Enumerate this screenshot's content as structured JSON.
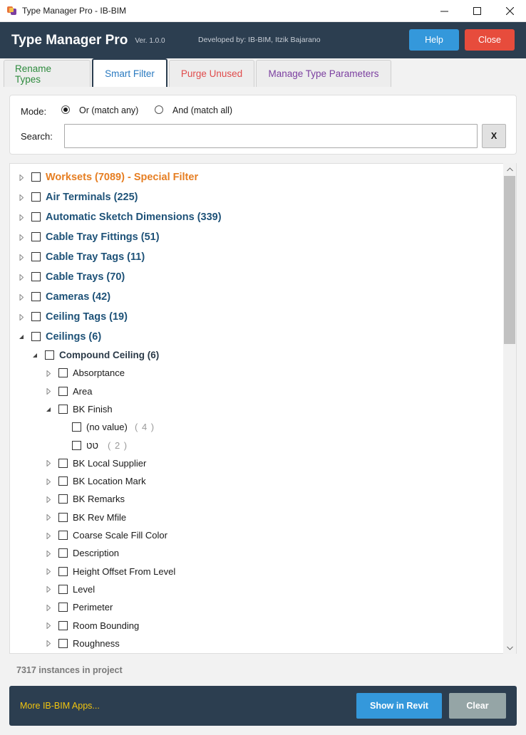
{
  "window": {
    "title": "Type Manager Pro - IB-BIM"
  },
  "header": {
    "brand": "Type Manager Pro",
    "version": "Ver. 1.0.0",
    "developer": "Developed by: IB-BIM, Itzik Bajarano",
    "help_label": "Help",
    "close_label": "Close"
  },
  "tabs": [
    {
      "label": "Rename Types",
      "active": false
    },
    {
      "label": "Smart Filter",
      "active": true
    },
    {
      "label": "Purge Unused",
      "active": false
    },
    {
      "label": "Manage Type Parameters",
      "active": false
    }
  ],
  "filter": {
    "mode_label": "Mode:",
    "mode_or": "Or (match any)",
    "mode_and": "And (match all)",
    "mode_selected": "or",
    "search_label": "Search:",
    "search_value": "",
    "clear_label": "X"
  },
  "tree": {
    "categories": [
      {
        "label": "Worksets (7089)  - Special Filter",
        "special": true,
        "expanded": false
      },
      {
        "label": "Air Terminals (225)",
        "expanded": false
      },
      {
        "label": "Automatic Sketch Dimensions (339)",
        "expanded": false
      },
      {
        "label": "Cable Tray Fittings (51)",
        "expanded": false
      },
      {
        "label": "Cable Tray Tags (11)",
        "expanded": false
      },
      {
        "label": "Cable Trays (70)",
        "expanded": false
      },
      {
        "label": "Cameras (42)",
        "expanded": false
      },
      {
        "label": "Ceiling Tags (19)",
        "expanded": false
      },
      {
        "label": "Ceilings (6)",
        "expanded": true
      }
    ],
    "family": {
      "label": "Compound Ceiling (6)",
      "expanded": true
    },
    "parameters_before": [
      {
        "label": "Absorptance"
      },
      {
        "label": "Area"
      }
    ],
    "bk_finish": {
      "label": "BK Finish",
      "values": [
        {
          "label": "(no value)",
          "count": "( 4 )"
        },
        {
          "label": "טט",
          "count": "( 2 )"
        }
      ]
    },
    "parameters_after": [
      {
        "label": "BK Local Supplier"
      },
      {
        "label": "BK Location Mark"
      },
      {
        "label": "BK Remarks"
      },
      {
        "label": "BK Rev Mfile"
      },
      {
        "label": "Coarse Scale Fill Color"
      },
      {
        "label": "Description"
      },
      {
        "label": "Height Offset From Level"
      },
      {
        "label": "Level"
      },
      {
        "label": "Perimeter"
      },
      {
        "label": "Room Bounding"
      },
      {
        "label": "Roughness"
      }
    ]
  },
  "status": "7317 instances in project",
  "footer": {
    "more_apps": "More IB-BIM Apps...",
    "show_label": "Show in Revit",
    "clear_label": "Clear"
  }
}
